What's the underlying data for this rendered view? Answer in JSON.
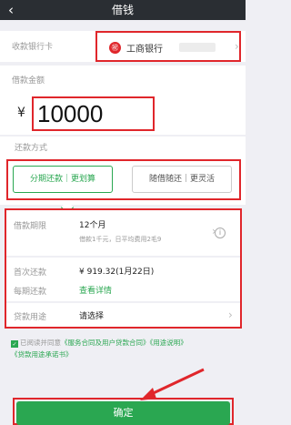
{
  "header": {
    "title": "借钱",
    "back_icon": "back-arrow-icon"
  },
  "bank": {
    "label": "收款银行卡",
    "bank_name": "工商银行",
    "logo_text": "㊗"
  },
  "amount": {
    "label": "借款金额",
    "currency": "¥",
    "value": "10000"
  },
  "method": {
    "label": "还款方式",
    "options": [
      {
        "label": "分期还款｜更划算",
        "selected": true
      },
      {
        "label": "随借随还｜更灵活",
        "selected": false
      }
    ]
  },
  "details": {
    "term_label": "借款期限",
    "term_value": "12个月",
    "term_note": "借款1千元，日平均费用2毛9",
    "first_label": "首次还款",
    "first_value": "¥ 919.32(1月22日)",
    "monthly_label": "每期还款",
    "monthly_link": "查看详情",
    "purpose_label": "贷款用途",
    "purpose_value": "请选择"
  },
  "agreement": {
    "prefix": "已阅读并同意",
    "link1": "《服务合同及用户贷款合同》",
    "link2": "《用途说明》",
    "link3": "《贷款用途承诺书》"
  },
  "confirm": {
    "label": "确定"
  },
  "colors": {
    "accent_green": "#2aa751",
    "annotation_red": "#e0262b",
    "header_bg": "#2a2e33"
  }
}
